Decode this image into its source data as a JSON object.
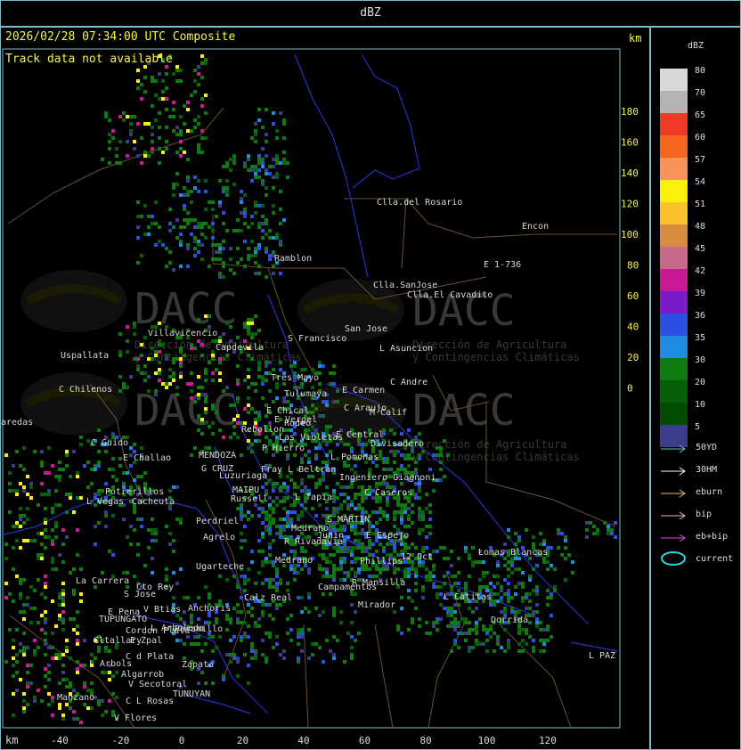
{
  "window": {
    "title": "dBZ"
  },
  "header": {
    "timestamp": "2026/02/28 07:34:00 UTC Composite",
    "track_status": "Track data not available",
    "km_unit_top": "km",
    "km_unit_bottom": "km"
  },
  "axes": {
    "y_ticks": [
      "180",
      "160",
      "140",
      "120",
      "100",
      "80",
      "60",
      "40",
      "20",
      "0"
    ],
    "x_ticks": [
      "-40",
      "-20",
      "0",
      "20",
      "40",
      "60",
      "80",
      "100",
      "120"
    ]
  },
  "watermark": {
    "logo": "DACC",
    "line1": "Dirección de Agricultura",
    "line2": "y Contingencias Climáticas"
  },
  "places": [
    "Clla.del_Rosario",
    "Encon",
    "E_1-736",
    "Ramblon",
    "Clla.SanJose",
    "Clla.El_Cavadito",
    "Villavicencio",
    "Capdevila",
    "S_Francisco",
    "San Jose",
    "L_Asuncion",
    "Uspallata",
    "C_Chilenos",
    "Tres_Mayo",
    "E_Carmen",
    "C_Andre",
    "Tulumaya",
    "C_Araujo",
    "M_Calif",
    "E_Chical",
    "E_Vergel",
    "Rodeo",
    "Rebollon",
    "Las_Violetas",
    "E_Central",
    "Divisadero",
    "C_Guido",
    "E_Challao",
    "MENDOZA",
    "P_Hierro",
    "L_Pomonas",
    "G_CRUZ",
    "Luzuriaga",
    "Fray_L_Beltran",
    "Ingeniero_Giagnoni",
    "MAIPU",
    "Russell",
    "C_Caseros",
    "Potrerillos",
    "L_Vegas",
    "Cacheuta",
    "L_Tapia",
    "Perdriel",
    "S_MARTIN",
    "Agrelo",
    "Medrano",
    "Junin",
    "E_Espejo",
    "Ugarteche",
    "R_Rivadavia",
    "Lomas_Blancas",
    "La_Carrera",
    "Cto_Rey",
    "12_Oct",
    "Phillips",
    "S_Jose",
    "Medrano",
    "L_Catitas",
    "E_Pena",
    "Anchoris",
    "Calz_Real",
    "Campamentos",
    "R_Mansilla",
    "TUPUNGATO",
    "V_Btias",
    "Mirador",
    "Dorrida",
    "Cordon_Plata",
    "L_Arboleda",
    "Gltallary",
    "E_Zpal",
    "Paramillo",
    "L_Arbols",
    "Zapata",
    "L_PAZ",
    "C_d_Plata",
    "Algarrob",
    "V_Secotoral",
    "TUNUYAN",
    "Manzano",
    "C_L_Rosas",
    "V_Flores",
    "aredas"
  ],
  "legend": {
    "title": "dBZ",
    "levels": [
      {
        "label": "80",
        "color": "#d8d8d8"
      },
      {
        "label": "70",
        "color": "#b4b4b4"
      },
      {
        "label": "65",
        "color": "#f03a28"
      },
      {
        "label": "60",
        "color": "#f6641e"
      },
      {
        "label": "57",
        "color": "#f89458"
      },
      {
        "label": "54",
        "color": "#faf00a"
      },
      {
        "label": "51",
        "color": "#fac22c"
      },
      {
        "label": "48",
        "color": "#d88c40"
      },
      {
        "label": "45",
        "color": "#c86a8a"
      },
      {
        "label": "42",
        "color": "#cc1a96"
      },
      {
        "label": "39",
        "color": "#7a1ac8"
      },
      {
        "label": "36",
        "color": "#2a50e4"
      },
      {
        "label": "35",
        "color": "#1e8ce0"
      },
      {
        "label": "30",
        "color": "#0e7a10"
      },
      {
        "label": "20",
        "color": "#076008"
      },
      {
        "label": "10",
        "color": "#044c04"
      },
      {
        "label": "5",
        "color": "#3c3c8c"
      }
    ],
    "tracks": [
      {
        "label": "50YD",
        "color": "#4cc8d8"
      },
      {
        "label": "30HM",
        "color": "#ffffff"
      },
      {
        "label": "eburn",
        "color": "#e8b86a"
      },
      {
        "label": "bip",
        "color": "#f0b4c8"
      },
      {
        "label": "eb+bip",
        "color": "#e04ce0"
      },
      {
        "label": "current",
        "color": "#2ad8e0"
      }
    ]
  }
}
